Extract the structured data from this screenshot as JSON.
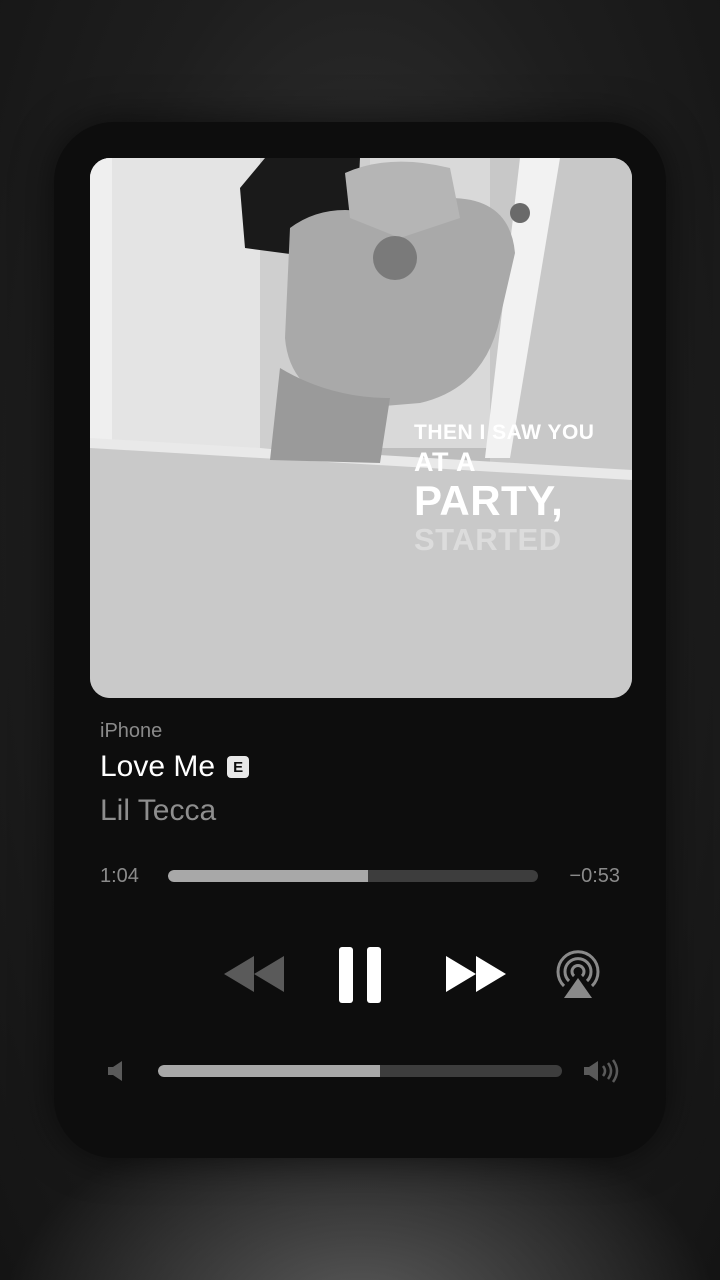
{
  "player": {
    "device": "iPhone",
    "title": "Love Me",
    "explicit_badge": "E",
    "artist": "Lil Tecca",
    "time_elapsed": "1:04",
    "time_remaining": "−0:53",
    "progress": 0.54,
    "volume": 0.55
  },
  "artwork": {
    "lyric_lines": [
      "THEN I SAW YOU",
      "AT A",
      "PARTY,",
      "STARTED"
    ]
  },
  "controls": {
    "previous_icon": "backward-icon",
    "pause_icon": "pause-icon",
    "next_icon": "forward-icon",
    "airplay_icon": "airplay-icon",
    "volume_low_icon": "speaker-low-icon",
    "volume_high_icon": "speaker-high-icon"
  },
  "colors": {
    "card": "#0d0d0d",
    "progress_fill": "#a8a8a8",
    "track": "#3d3d3d",
    "text_primary": "#ffffff",
    "text_secondary": "#8e8e8e"
  }
}
